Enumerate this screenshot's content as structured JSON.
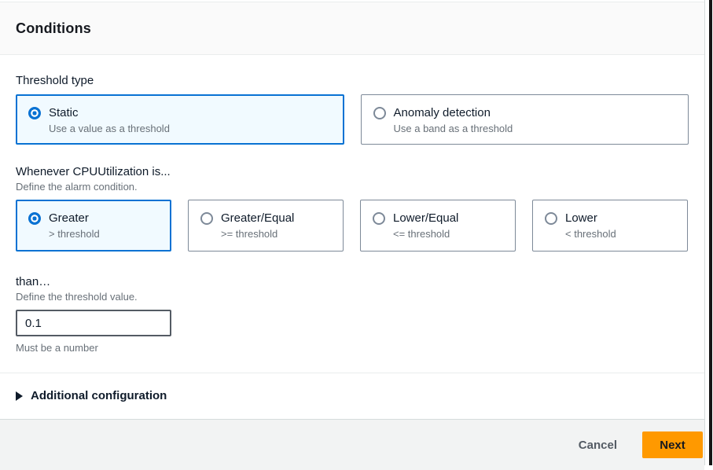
{
  "panel": {
    "title": "Conditions",
    "threshold_type": {
      "label": "Threshold type",
      "options": [
        {
          "label": "Static",
          "description": "Use a value as a threshold",
          "selected": true
        },
        {
          "label": "Anomaly detection",
          "description": "Use a band as a threshold",
          "selected": false
        }
      ]
    },
    "condition": {
      "label": "Whenever CPUUtilization is...",
      "sublabel": "Define the alarm condition.",
      "options": [
        {
          "label": "Greater",
          "description": "> threshold",
          "selected": true
        },
        {
          "label": "Greater/Equal",
          "description": ">= threshold",
          "selected": false
        },
        {
          "label": "Lower/Equal",
          "description": "<= threshold",
          "selected": false
        },
        {
          "label": "Lower",
          "description": "< threshold",
          "selected": false
        }
      ]
    },
    "threshold_value": {
      "label": "than…",
      "sublabel": "Define the threshold value.",
      "value": "0.1",
      "hint": "Must be a number"
    },
    "additional_configuration": {
      "label": "Additional configuration",
      "icon": "triangle-right-icon",
      "expanded": false
    }
  },
  "footer": {
    "cancel_label": "Cancel",
    "next_label": "Next"
  },
  "colors": {
    "accent_blue": "#0972d3",
    "selected_tile_bg": "#f1faff",
    "primary_button_orange": "#ff9900",
    "footer_bg": "#f2f3f3",
    "divider": "#eaeded",
    "secondary_text": "#687078"
  }
}
